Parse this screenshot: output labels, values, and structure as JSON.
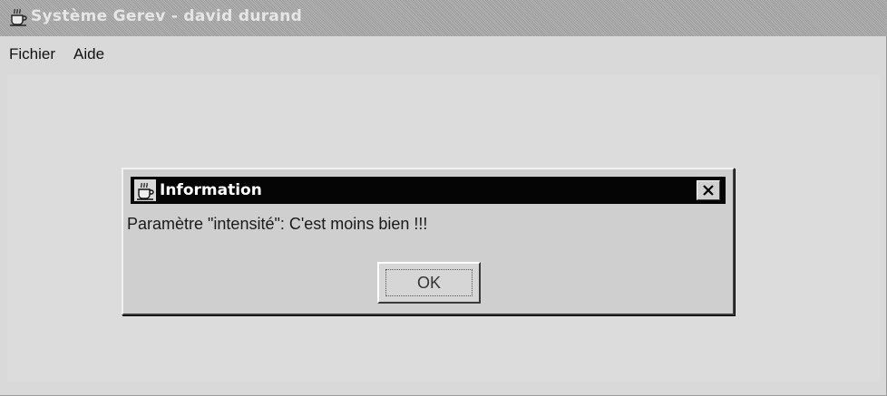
{
  "window": {
    "title": "Système Gerev - david durand",
    "icon": "java-cup-icon"
  },
  "menubar": {
    "items": [
      {
        "label": "Fichier"
      },
      {
        "label": "Aide"
      }
    ]
  },
  "dialog": {
    "title": "Information",
    "icon": "java-cup-icon",
    "close_glyph": "✕",
    "message": "Paramètre \"intensité\": C'est moins bien !!!",
    "ok_label": "OK"
  },
  "colors": {
    "dialog_title_bg": "#050505",
    "window_bg": "#d9d9d9",
    "main_titlebar_bg": "#a8a8a8"
  }
}
